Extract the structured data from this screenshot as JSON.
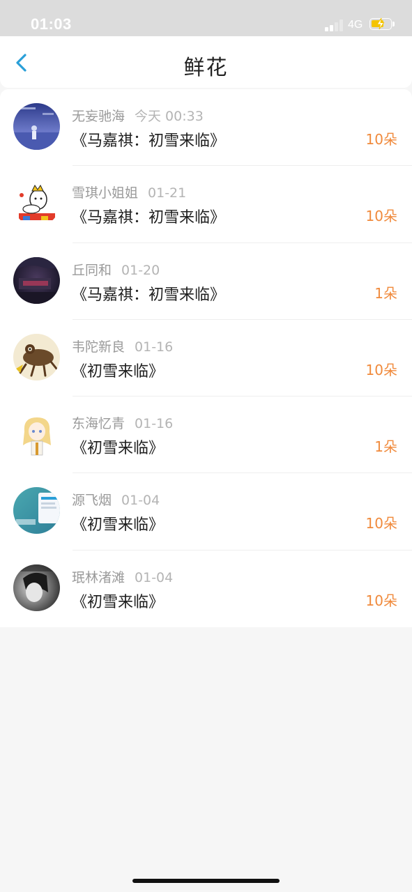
{
  "status_bar": {
    "time": "01:03",
    "network": "4G"
  },
  "header": {
    "title": "鲜花",
    "back_icon": "chevron-left-icon"
  },
  "colors": {
    "accent": "#2a9fd8",
    "count": "#f08a3c",
    "battery": "#f4c400"
  },
  "items": [
    {
      "name": "无妄驰海",
      "date": "今天 00:33",
      "title": "《马嘉祺：初雪来临》",
      "count": "10朵"
    },
    {
      "name": "雪琪小姐姐",
      "date": "01-21",
      "title": "《马嘉祺：初雪来临》",
      "count": "10朵"
    },
    {
      "name": "丘同和",
      "date": "01-20",
      "title": "《马嘉祺：初雪来临》",
      "count": "1朵"
    },
    {
      "name": "韦陀新良",
      "date": "01-16",
      "title": "《初雪来临》",
      "count": "10朵"
    },
    {
      "name": "东海忆青",
      "date": "01-16",
      "title": "《初雪来临》",
      "count": "1朵"
    },
    {
      "name": "源飞烟",
      "date": "01-04",
      "title": "《初雪来临》",
      "count": "10朵"
    },
    {
      "name": "珉林渚滩",
      "date": "01-04",
      "title": "《初雪来临》",
      "count": "10朵"
    }
  ]
}
